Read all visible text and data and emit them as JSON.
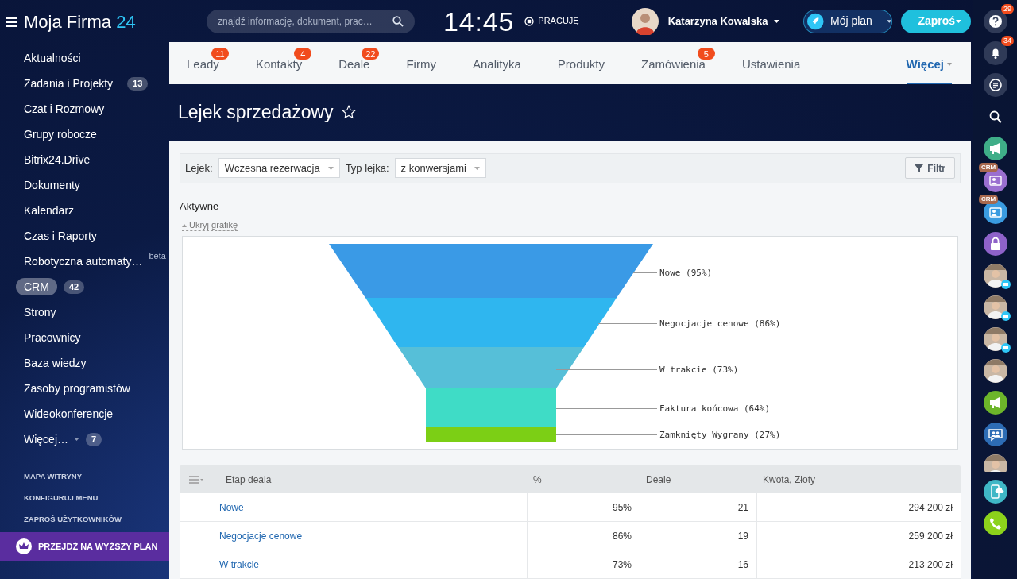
{
  "header": {
    "logo": {
      "name": "Moja Firma",
      "suffix": "24"
    },
    "search": {
      "placeholder": "znajdź informację, dokument, prac…"
    },
    "clock": "14:45",
    "work_status": "PRACUJĘ",
    "user": {
      "name": "Katarzyna Kowalska"
    },
    "plan_button": "Mój plan",
    "invite_button": "Zaproś"
  },
  "sidebar": {
    "items": [
      {
        "label": "Aktualności",
        "selected": false
      },
      {
        "label": "Zadania i Projekty",
        "counter": "13",
        "selected": false
      },
      {
        "label": "Czat i Rozmowy",
        "selected": false
      },
      {
        "label": "Grupy robocze",
        "selected": false
      },
      {
        "label": "Bitrix24.Drive",
        "selected": false
      },
      {
        "label": "Dokumenty",
        "selected": false
      },
      {
        "label": "Kalendarz",
        "selected": false
      },
      {
        "label": "Czas i Raporty",
        "selected": false
      },
      {
        "label": "Robotyczna automaty…",
        "tag": "beta",
        "selected": false
      },
      {
        "label": "CRM",
        "counter": "42",
        "selected": true
      },
      {
        "label": "Strony",
        "selected": false
      },
      {
        "label": "Pracownicy",
        "selected": false
      },
      {
        "label": "Baza wiedzy",
        "selected": false
      },
      {
        "label": "Zasoby programistów",
        "selected": false
      },
      {
        "label": "Wideokonferencje",
        "selected": false
      },
      {
        "label": "Więcej…",
        "counter": "7",
        "caret": true,
        "selected": false
      }
    ],
    "links": [
      "MAPA WITRYNY",
      "KONFIGURUJ MENU",
      "ZAPROŚ UŻYTKOWNIKÓW"
    ],
    "upgrade": "PRZEJDŹ NA WYŻSZY PLAN"
  },
  "tabs": [
    {
      "label": "Leady",
      "badge": "11",
      "selected": false
    },
    {
      "label": "Kontakty",
      "badge": "4",
      "selected": false
    },
    {
      "label": "Deale",
      "badge": "22",
      "selected": false
    },
    {
      "label": "Firmy",
      "selected": false
    },
    {
      "label": "Analityka",
      "selected": false
    },
    {
      "label": "Produkty",
      "selected": false
    },
    {
      "label": "Zamówienia",
      "badge": "5",
      "selected": false
    },
    {
      "label": "Ustawienia",
      "selected": false
    },
    {
      "label": "Więcej",
      "selected": true
    }
  ],
  "page_title": "Lejek sprzedażowy",
  "filters": {
    "funnel_label": "Lejek:",
    "funnel_value": "Wczesna rezerwacja",
    "type_label": "Typ lejka:",
    "type_value": "z konwersjami",
    "filter_button": "Filtr"
  },
  "section_title": "Aktywne",
  "hide_chart_link": "Ukryj grafikę",
  "funnel": {
    "stages": [
      {
        "label": "Nowe (95%)",
        "color": "#3a9ae6"
      },
      {
        "label": "Negocjacje cenowe (86%)",
        "color": "#2fb6ef"
      },
      {
        "label": "W trakcie (73%)",
        "color": "#56bfd8"
      },
      {
        "label": "Faktura końcowa (64%)",
        "color": "#3fdcc6"
      },
      {
        "label": "Zamknięty Wygrany (27%)",
        "color": "#7ccf15"
      }
    ]
  },
  "table": {
    "columns": [
      "Etap deala",
      "%",
      "Deale",
      "Kwota, Złoty"
    ],
    "rows": [
      [
        "Nowe",
        "95%",
        "21",
        "294 200 zł"
      ],
      [
        "Negocjacje cenowe",
        "86%",
        "19",
        "259 200 zł"
      ],
      [
        "W trakcie",
        "73%",
        "16",
        "213 200 zł"
      ]
    ]
  },
  "rail": [
    {
      "kind": "help",
      "badge": "29"
    },
    {
      "kind": "bell",
      "badge": "34"
    },
    {
      "kind": "chat"
    },
    {
      "kind": "search"
    },
    {
      "kind": "megaphone",
      "color": "#3fae88"
    },
    {
      "kind": "crm",
      "badge": "CRM",
      "color": "#9a6fd0"
    },
    {
      "kind": "crm",
      "badge": "CRM",
      "color": "#3a9be0"
    },
    {
      "kind": "lock",
      "color": "#8e62c9"
    },
    {
      "kind": "avatar",
      "mail": true
    },
    {
      "kind": "avatar",
      "mail": true
    },
    {
      "kind": "avatar",
      "mail": true
    },
    {
      "kind": "avatar",
      "mail": false
    },
    {
      "kind": "megaphone",
      "color": "#6cb52a"
    },
    {
      "kind": "group",
      "color": "#2d6cb5"
    },
    {
      "kind": "avatar",
      "mail": false
    },
    {
      "kind": "device",
      "color": "#3fb7c6"
    },
    {
      "kind": "phone",
      "color": "#8cd21b"
    }
  ]
}
